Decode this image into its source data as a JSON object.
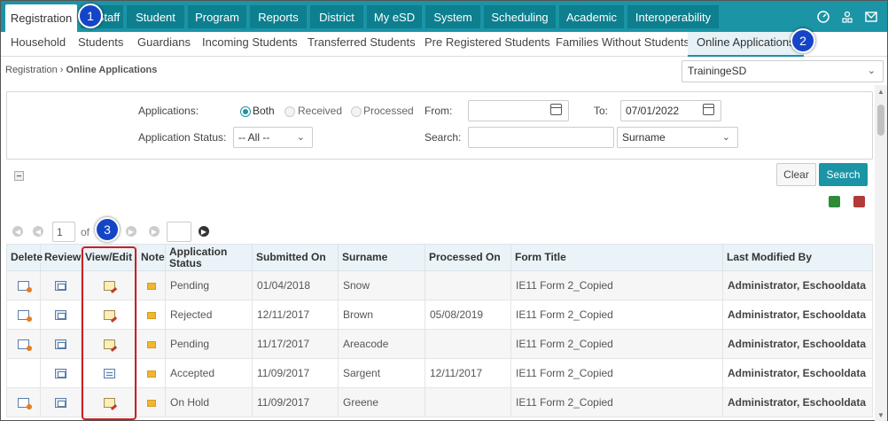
{
  "top_nav": {
    "tabs": [
      "Registration",
      "Staff",
      "Student",
      "Program",
      "Reports",
      "District",
      "My eSD",
      "System",
      "Scheduling",
      "Academic",
      "Interoperability"
    ],
    "active_tab": "Registration",
    "icons": [
      "dashboard-icon",
      "user-tree-icon",
      "mail-icon"
    ]
  },
  "sub_nav": {
    "tabs": [
      "Household",
      "Students",
      "Guardians",
      "Incoming Students",
      "Transferred Students",
      "Pre Registered Students",
      "Families Without Students",
      "Online Applications"
    ],
    "active_tab": "Online Applications"
  },
  "breadcrumb": {
    "parent": "Registration",
    "current": "Online Applications"
  },
  "district_select": {
    "value": "TrainingeSD"
  },
  "filters": {
    "applications_label": "Applications:",
    "options": [
      "Both",
      "Received",
      "Processed"
    ],
    "selected_option": "Both",
    "from_label": "From:",
    "from_value": "",
    "to_label": "To:",
    "to_value": "07/01/2022",
    "status_label": "Application Status:",
    "status_value": "-- All --",
    "search_label": "Search:",
    "search_value": "",
    "search_by_value": "Surname"
  },
  "buttons": {
    "clear": "Clear",
    "search": "Search"
  },
  "pager": {
    "page": "1",
    "of_label": "of",
    "total_pages": ""
  },
  "table": {
    "headers": [
      "Delete",
      "Review",
      "View/Edit",
      "Note",
      "Application Status",
      "Submitted On",
      "Surname",
      "Processed On",
      "Form Title",
      "Last Modified By"
    ],
    "rows": [
      {
        "status": "Pending",
        "submitted": "01/04/2018",
        "surname": "Snow",
        "processed": "",
        "form": "IE11 Form 2_Copied",
        "modified_by": "Administrator, Eschooldata",
        "has_delete": true,
        "view_icon": "edit-icon"
      },
      {
        "status": "Rejected",
        "submitted": "12/11/2017",
        "surname": "Brown",
        "processed": "05/08/2019",
        "form": "IE11 Form 2_Copied",
        "modified_by": "Administrator, Eschooldata",
        "has_delete": true,
        "view_icon": "edit-icon"
      },
      {
        "status": "Pending",
        "submitted": "11/17/2017",
        "surname": "Areacode",
        "processed": "",
        "form": "IE11 Form 2_Copied",
        "modified_by": "Administrator, Eschooldata",
        "has_delete": true,
        "view_icon": "edit-icon"
      },
      {
        "status": "Accepted",
        "submitted": "11/09/2017",
        "surname": "Sargent",
        "processed": "12/11/2017",
        "form": "IE11 Form 2_Copied",
        "modified_by": "Administrator, Eschooldata",
        "has_delete": false,
        "view_icon": "view-icon"
      },
      {
        "status": "On Hold",
        "submitted": "11/09/2017",
        "surname": "Greene",
        "processed": "",
        "form": "IE11 Form 2_Copied",
        "modified_by": "Administrator, Eschooldata",
        "has_delete": true,
        "view_icon": "edit-icon"
      }
    ]
  },
  "callouts": [
    "1",
    "2",
    "3"
  ],
  "colors": {
    "accent": "#1b94a6",
    "accent_dark": "#0d7f8f",
    "callout": "#1545c7",
    "highlight_border": "#cc2020"
  }
}
